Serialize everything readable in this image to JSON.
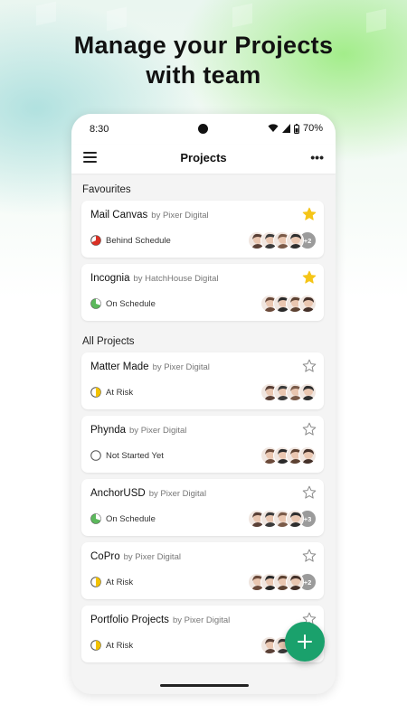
{
  "headline": {
    "line1": "Manage your Projects",
    "line2": "with team"
  },
  "statusbar": {
    "time": "8:30",
    "battery": "70%"
  },
  "appbar": {
    "title": "Projects"
  },
  "sections": {
    "favourites": "Favourites",
    "all": "All Projects"
  },
  "colors": {
    "accent": "#1aa16c",
    "star_active": "#f5c518",
    "behind": "#d93025",
    "on_schedule": "#5cb85c",
    "at_risk": "#f2c200"
  },
  "projects": [
    {
      "name": "Mail Canvas",
      "owner": "by Pixer Digital",
      "status": "Behind Schedule",
      "status_type": "behind",
      "favourite": true,
      "more_members": "+2"
    },
    {
      "name": "Incognia",
      "owner": "by HatchHouse Digital",
      "status": "On Schedule",
      "status_type": "on_schedule",
      "favourite": true,
      "more_members": ""
    },
    {
      "name": "Matter Made",
      "owner": "by Pixer Digital",
      "status": "At Risk",
      "status_type": "at_risk",
      "favourite": false,
      "more_members": ""
    },
    {
      "name": "Phynda",
      "owner": "by Pixer Digital",
      "status": "Not Started Yet",
      "status_type": "not_started",
      "favourite": false,
      "more_members": ""
    },
    {
      "name": "AnchorUSD",
      "owner": "by Pixer Digital",
      "status": "On Schedule",
      "status_type": "on_schedule",
      "favourite": false,
      "more_members": "+3"
    },
    {
      "name": "CoPro",
      "owner": "by Pixer Digital",
      "status": "At Risk",
      "status_type": "at_risk",
      "favourite": false,
      "more_members": "+2"
    },
    {
      "name": "Portfolio Projects",
      "owner": "by Pixer Digital",
      "status": "At Risk",
      "status_type": "at_risk",
      "favourite": false,
      "more_members": ""
    }
  ],
  "icons": {
    "menu": "hamburger-icon",
    "more": "more-dots-icon",
    "fab": "plus-icon",
    "star_on": "star-filled-icon",
    "star_off": "star-outline-icon"
  }
}
